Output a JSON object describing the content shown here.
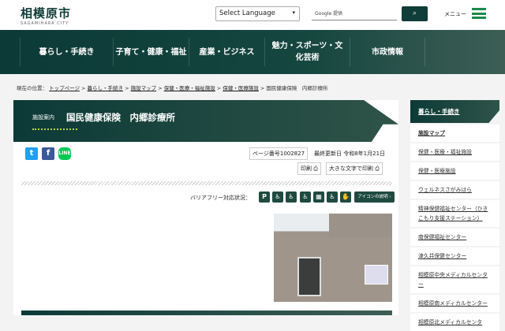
{
  "header": {
    "logo_jp": "相模原市",
    "logo_en": "SAGAMIHARA CITY",
    "language_select": "Select Language",
    "search_placeholder": "Google 提供",
    "search_icon": "search-icon",
    "menu_label": "メニュー"
  },
  "nav": [
    "暮らし・手続き",
    "子育て・健康・福祉",
    "産業・ビジネス",
    "魅力・スポーツ・文化芸術",
    "市政情報"
  ],
  "breadcrumb": {
    "prefix": "現在の位置：",
    "links": [
      "トップページ",
      "暮らし・手続き",
      "施設マップ",
      "保健・医療・福祉施設",
      "保健・医療施設"
    ],
    "current": "国民健康保険　内郷診療所",
    "sep": " > "
  },
  "title": {
    "category": "施設案内",
    "name": "国民健康保険　内郷診療所"
  },
  "social": [
    "twitter",
    "facebook",
    "line"
  ],
  "page_number": "ページ番号1002827",
  "updated": "最終更新日 令和8年1月21日",
  "print": "印刷",
  "print_large": "大きな文字で印刷",
  "barrier_free": {
    "label": "バリアフリー対応状況：",
    "icons": [
      "P",
      "♿",
      "♿",
      "♿",
      "▦",
      "♿",
      "✋"
    ],
    "explain": "アイコンの説明"
  },
  "sidebar": {
    "heading": "暮らし・手続き",
    "items": [
      "施設マップ",
      "保健・医療・福祉施設",
      "保健・医療施設",
      "ウェルネスさがみはら",
      "精神保健福祉センター（ひきこもり支援ステーション）",
      "南保健福祉センター",
      "津久井保健センター",
      "相模原中央メディカルセンター",
      "相模原南メディカルセンター",
      "相模原北メディカルセンタ"
    ]
  }
}
